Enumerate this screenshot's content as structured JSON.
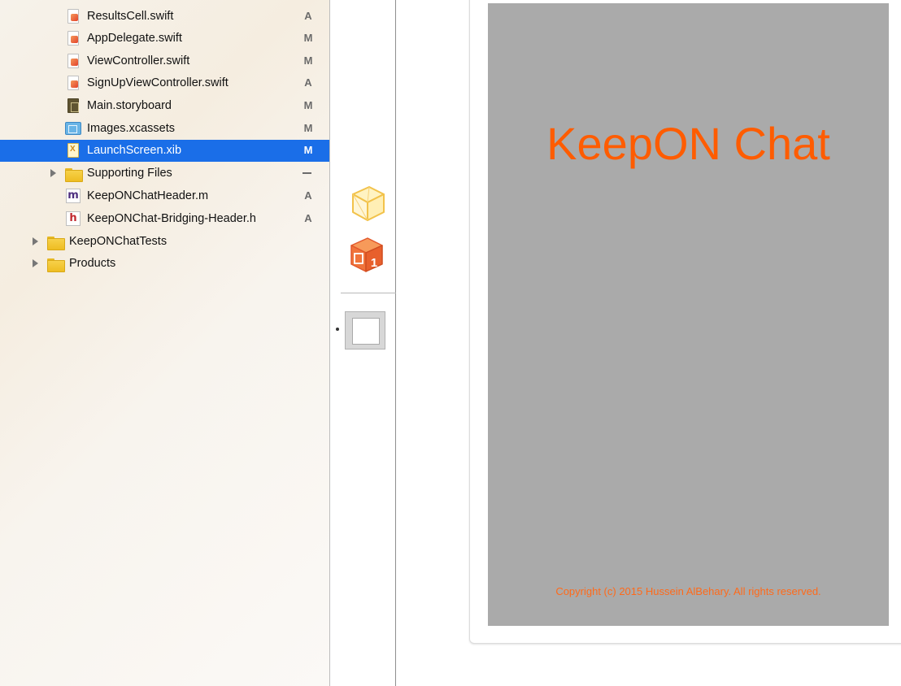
{
  "navigator": {
    "rows": [
      {
        "label": "ResultsCell.swift",
        "status": "A",
        "icon": "swift-file-icon"
      },
      {
        "label": "AppDelegate.swift",
        "status": "M",
        "icon": "swift-file-icon"
      },
      {
        "label": "ViewController.swift",
        "status": "M",
        "icon": "swift-file-icon"
      },
      {
        "label": "SignUpViewController.swift",
        "status": "A",
        "icon": "swift-file-icon"
      },
      {
        "label": "Main.storyboard",
        "status": "M",
        "icon": "storyboard-file-icon"
      },
      {
        "label": "Images.xcassets",
        "status": "M",
        "icon": "asset-catalog-icon"
      },
      {
        "label": "LaunchScreen.xib",
        "status": "M",
        "icon": "xib-file-icon",
        "selected": true
      },
      {
        "label": "Supporting Files",
        "status": "",
        "icon": "folder-icon"
      },
      {
        "label": "KeepONChatHeader.m",
        "status": "A",
        "icon": "m-file-icon"
      },
      {
        "label": "KeepONChat-Bridging-Header.h",
        "status": "A",
        "icon": "h-file-icon"
      },
      {
        "label": "KeepONChatTests",
        "status": "",
        "icon": "folder-icon"
      },
      {
        "label": "Products",
        "status": "",
        "icon": "folder-icon"
      }
    ],
    "letter_m": "m",
    "letter_h": "h"
  },
  "dock": {
    "items": [
      "files-owner-icon",
      "first-responder-icon",
      "view-icon"
    ],
    "first_responder_badge": "1"
  },
  "canvas": {
    "app_title": "KeepON Chat",
    "copyright": "Copyright (c) 2015 Hussein AlBehary. All rights reserved.",
    "background_color": "#aaaaaa",
    "title_color": "#ff5c00"
  },
  "colors": {
    "selection": "#1a6ee8",
    "folder": "#f2c53a"
  }
}
